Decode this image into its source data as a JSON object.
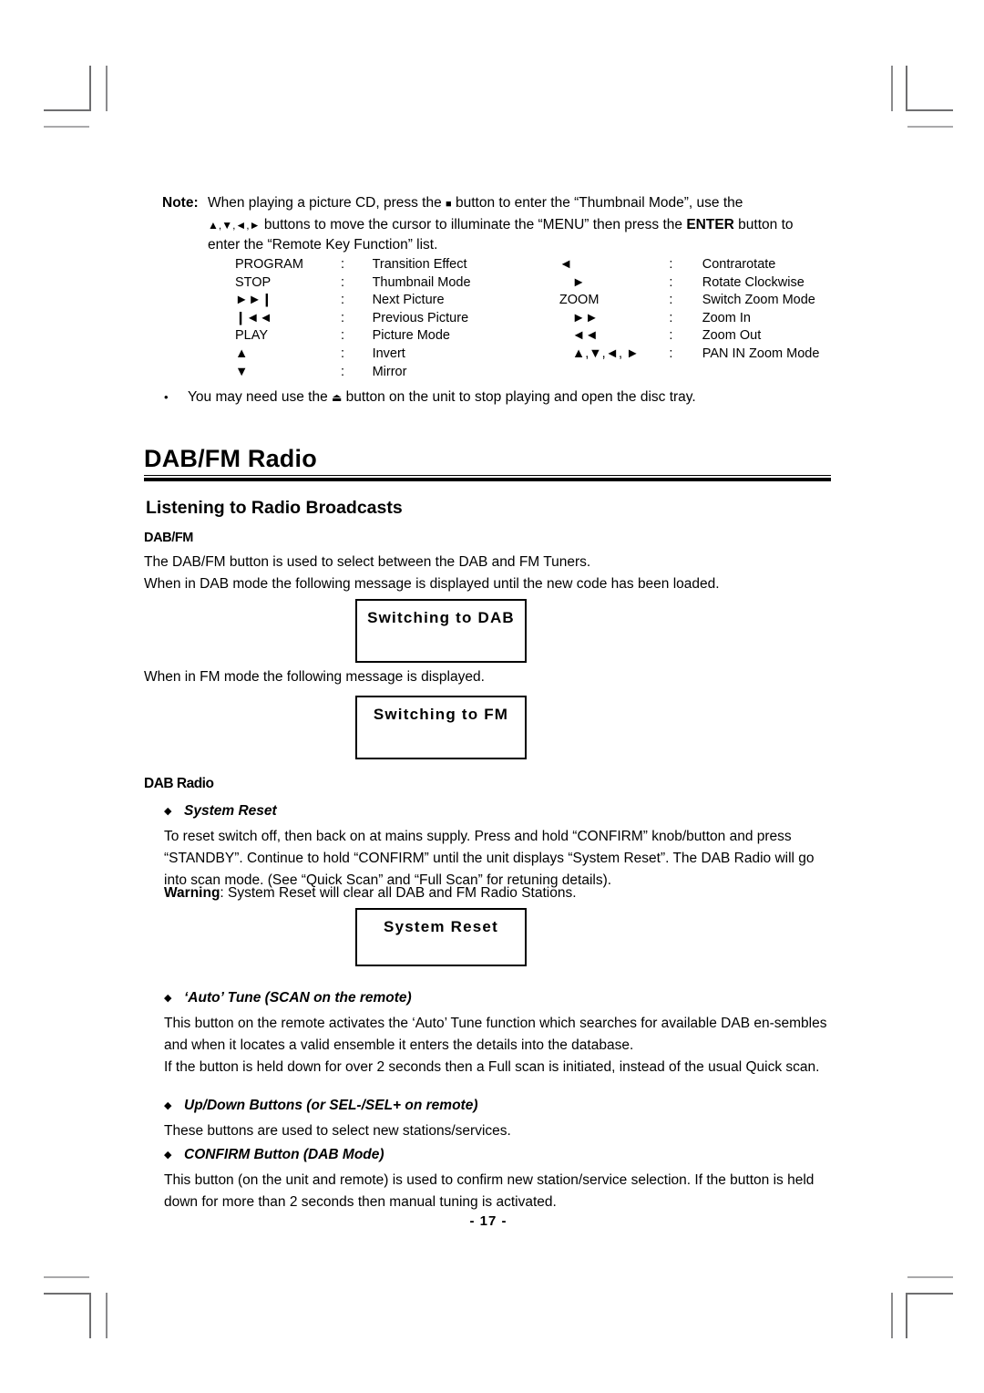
{
  "note": {
    "label": "Note:",
    "line1_a": "When playing a picture CD, press the ",
    "line1_sym": "■",
    "line1_b": " button to enter the “Thumbnail Mode”, use the",
    "line2_sym": "▲,▼,◄,►",
    "line2_a": " buttons to move the cursor to illuminate the “MENU” then press the ",
    "line2_bold": "ENTER",
    "line2_b": " button to",
    "line3": "enter the “Remote Key Function” list."
  },
  "key_function_table": {
    "left": [
      {
        "key": "PROGRAM",
        "colon": ":",
        "value": "Transition Effect"
      },
      {
        "key": "STOP",
        "colon": ":",
        "value": "Thumbnail Mode"
      },
      {
        "key": "►►❙",
        "colon": ":",
        "value": "Next Picture"
      },
      {
        "key": "❙◄◄",
        "colon": ":",
        "value": "Previous Picture"
      },
      {
        "key": "PLAY",
        "colon": ":",
        "value": "Picture Mode"
      },
      {
        "key": "▲",
        "colon": ":",
        "value": "Invert"
      },
      {
        "key": "▼",
        "colon": ":",
        "value": "Mirror"
      }
    ],
    "right": [
      {
        "key": "◄",
        "colon": ":",
        "value": "Contrarotate"
      },
      {
        "key": "►",
        "colon": ":",
        "value": "Rotate Clockwise"
      },
      {
        "key": "ZOOM",
        "colon": ":",
        "value": "Switch Zoom Mode"
      },
      {
        "key": "►►",
        "colon": ":",
        "value": "Zoom In"
      },
      {
        "key": "◄◄",
        "colon": ":",
        "value": "Zoom Out"
      },
      {
        "key": "▲,▼,◄, ►",
        "colon": ":",
        "value": "PAN IN Zoom Mode"
      }
    ]
  },
  "bullet_eject": {
    "dot": "•",
    "text_a": "You may need use the ",
    "sym": "⏏",
    "text_b": " button on the unit to stop playing and open the disc tray."
  },
  "headings": {
    "main": "DAB/FM Radio",
    "sub": "Listening to Radio Broadcasts",
    "dabfm": "DAB/FM",
    "dab_radio": "DAB Radio"
  },
  "paragraphs": {
    "dabfm_p1": "The DAB/FM button is used to select between the DAB and FM Tuners.",
    "dabfm_p2": "When in DAB mode the following message is displayed until the new code has been loaded.",
    "fm_p1": "When in FM mode the following message is displayed.",
    "system_reset_p1": "To reset switch off, then back on at mains supply. Press and hold “CONFIRM” knob/button and press “STANDBY”. Continue to hold “CONFIRM” until the unit displays “System Reset”. The DAB Radio will go into scan mode. (See “Quick Scan” and “Full Scan” for retuning details).",
    "warning_label": "Warning",
    "warning_text": ": System Reset will clear all DAB and FM Radio Stations.",
    "auto_tune_p1": "This button on the remote activates the ‘Auto’ Tune function which searches for available DAB en-sembles and when it locates a valid ensemble it enters the details into the database.",
    "auto_tune_p2": "If the button is held down for over 2 seconds then a Full scan is initiated, instead of the usual Quick scan.",
    "updown_p1": "These buttons are used to select new stations/services.",
    "confirm_p1": "This button (on the unit and remote) is used to confirm new station/service selection. If the button is held down for more than 2 seconds then manual tuning is activated."
  },
  "display_boxes": {
    "switching_dab": "Switching to DAB",
    "switching_fm": "Switching to FM",
    "system_reset": "System Reset"
  },
  "bullets": {
    "dot": "◆",
    "system_reset": "System Reset",
    "auto_tune": "‘Auto’ Tune (SCAN on the remote)",
    "updown": "Up/Down Buttons (or SEL-/SEL+ on remote)",
    "confirm": "CONFIRM Button (DAB Mode)"
  },
  "footer": {
    "page_number": "- 17 -"
  }
}
